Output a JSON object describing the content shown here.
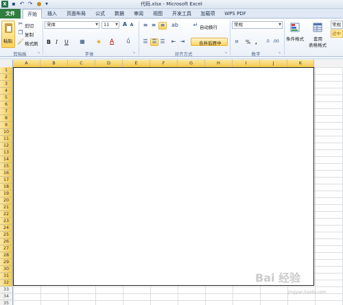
{
  "titlebar": {
    "logo": "X",
    "title": "代码.xlsx - Microsoft Excel"
  },
  "tabs": [
    "文件",
    "开始",
    "插入",
    "页面布局",
    "公式",
    "数据",
    "审阅",
    "视图",
    "开发工具",
    "加载项",
    "WPS PDF"
  ],
  "clipboard": {
    "paste": "粘贴",
    "cut": "剪切",
    "copy": "复制",
    "format_painter": "格式刷",
    "label": "剪贴板"
  },
  "font": {
    "name": "宋体",
    "size": "11",
    "bold": "B",
    "italic": "I",
    "underline": "U",
    "color_letter": "A",
    "label": "字体"
  },
  "alignment": {
    "wrap": "自动换行",
    "merge": "合并后居中",
    "label": "对齐方式"
  },
  "number": {
    "format": "常规",
    "percent": "%",
    "comma": ",",
    "label": "数字"
  },
  "styles": {
    "conditional": "条件格式",
    "table_format_1": "套用",
    "table_format_2": "表格格式",
    "cell_style_top": "常规",
    "cell_style_bottom": "适中"
  },
  "columns": [
    "A",
    "B",
    "C",
    "D",
    "E",
    "F",
    "G",
    "H",
    "I",
    "J",
    "K"
  ],
  "rows": [
    "1",
    "2",
    "3",
    "4",
    "5",
    "6",
    "7",
    "8",
    "9",
    "10",
    "11",
    "12",
    "13",
    "14",
    "15",
    "16",
    "17",
    "18",
    "19",
    "20",
    "21",
    "22",
    "23",
    "24",
    "25",
    "26",
    "27",
    "28",
    "29",
    "30",
    "31",
    "32",
    "33",
    "34",
    "35"
  ],
  "watermark": {
    "main": "Bai 经验",
    "sub": "jingyan.baidu.com"
  },
  "colors": {
    "accent": "#f5c94a",
    "file_tab": "#2f7d3f"
  }
}
